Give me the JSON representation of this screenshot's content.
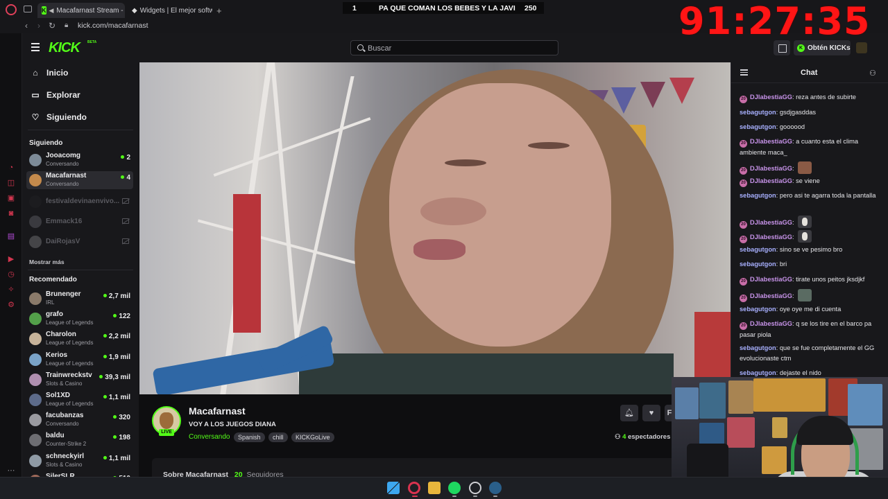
{
  "browser": {
    "tabs": [
      {
        "title": "Macafarnast Stream - V",
        "active": true
      },
      {
        "title": "Widgets | El mejor software",
        "active": false
      }
    ],
    "new_tab": "+",
    "url": "kick.com/macafarnast"
  },
  "overlay": {
    "score_left": "1",
    "score_title": "PA QUE COMAN LOS BEBES Y LA JAVI",
    "score_right": "250",
    "timer": "91:27:35"
  },
  "header": {
    "logo": "KICK",
    "logo_badge": "BETA",
    "search_placeholder": "Buscar",
    "kicks_button": "Obtén KICKs"
  },
  "sidebar": {
    "nav": [
      {
        "label": "Inicio",
        "icon": "home-icon"
      },
      {
        "label": "Explorar",
        "icon": "browse-icon"
      },
      {
        "label": "Siguiendo",
        "icon": "heart-icon"
      }
    ],
    "following_heading": "Siguiendo",
    "following": [
      {
        "name": "Jooacomg",
        "sub": "Conversando",
        "count": "2",
        "live": true
      },
      {
        "name": "Macafarnast",
        "sub": "Conversando",
        "count": "4",
        "live": true,
        "selected": true
      },
      {
        "name": "festivaldevinaenvivo...",
        "live": false
      },
      {
        "name": "Emmack16",
        "live": false
      },
      {
        "name": "DaiRojasV",
        "live": false
      }
    ],
    "show_more": "Mostrar más",
    "recommended_heading": "Recomendado",
    "recommended": [
      {
        "name": "Brunenger",
        "sub": "IRL",
        "count": "2,7 mil"
      },
      {
        "name": "grafo",
        "sub": "League of Legends",
        "count": "122"
      },
      {
        "name": "Charolon",
        "sub": "League of Legends",
        "count": "2,2 mil"
      },
      {
        "name": "Kerios",
        "sub": "League of Legends",
        "count": "1,9 mil"
      },
      {
        "name": "Trainwreckstv",
        "sub": "Slots & Casino",
        "count": "39,3 mil"
      },
      {
        "name": "Sol1XD",
        "sub": "League of Legends",
        "count": "1,1 mil"
      },
      {
        "name": "facubanzas",
        "sub": "Conversando",
        "count": "320"
      },
      {
        "name": "baldu",
        "sub": "Counter-Strike 2",
        "count": "198"
      },
      {
        "name": "schneckyirl",
        "sub": "Slots & Casino",
        "count": "1,1 mil"
      },
      {
        "name": "SilerSLR",
        "sub": "",
        "count": "510"
      }
    ]
  },
  "stream": {
    "channel": "Macafarnast",
    "live_badge": "LIVE",
    "title": "VOY A LOS JUEGOS DIANA",
    "category": "Conversando",
    "tags": [
      "Spanish",
      "chill",
      "KICKGoLive"
    ],
    "viewers_count": "4",
    "viewers_label": "espectadores",
    "follow_partial": "F",
    "about_label": "Sobre Macafarnast",
    "followers_count": "20",
    "followers_label": "Seguidores"
  },
  "chat": {
    "title": "Chat",
    "messages": [
      {
        "user": "DJlabestiaGG",
        "badge": true,
        "text": "reza antes de subirte"
      },
      {
        "user": "sebagutgon",
        "text": "gsdjgasddas"
      },
      {
        "user": "sebagutgon",
        "text": "goooood"
      },
      {
        "user": "DJlabestiaGG",
        "badge": true,
        "text": "a cuanto esta el clima ambiente maca_"
      },
      {
        "user": "DJlabestiaGG",
        "badge": true,
        "text": "",
        "emote": "brown"
      },
      {
        "user": "DJlabestiaGG",
        "badge": true,
        "text": "se viene"
      },
      {
        "user": "sebagutgon",
        "text": "pero asi te agarra toda la pantalla"
      },
      {
        "user": "DJlabestiaGG",
        "badge": true,
        "text": "",
        "emote": "skel"
      },
      {
        "user": "DJlabestiaGG",
        "badge": true,
        "text": "",
        "emote": "skel"
      },
      {
        "user": "sebagutgon",
        "text": "sino se ve pesimo bro"
      },
      {
        "user": "sebagutgon",
        "text": "bri"
      },
      {
        "user": "DJlabestiaGG",
        "badge": true,
        "text": "tirate unos peitos jksdjkf"
      },
      {
        "user": "DJlabestiaGG",
        "badge": true,
        "text": "",
        "emote": "char"
      },
      {
        "user": "sebagutgon",
        "text": "oye oye me di cuenta"
      },
      {
        "user": "DJlabestiaGG",
        "badge": true,
        "text": "q se los tire en el barco pa pasar piola"
      },
      {
        "user": "sebagutgon",
        "text": "que se fue completamente el GG evolucionaste ctm"
      },
      {
        "user": "sebagutgon",
        "text": "dejaste el nido"
      }
    ],
    "badge_text": "20"
  },
  "colors": {
    "kick_green": "#53fc18",
    "timer_red": "#ff1515",
    "chat_user_dj": "#c793e9",
    "chat_user_seba": "#a8b0ff"
  }
}
